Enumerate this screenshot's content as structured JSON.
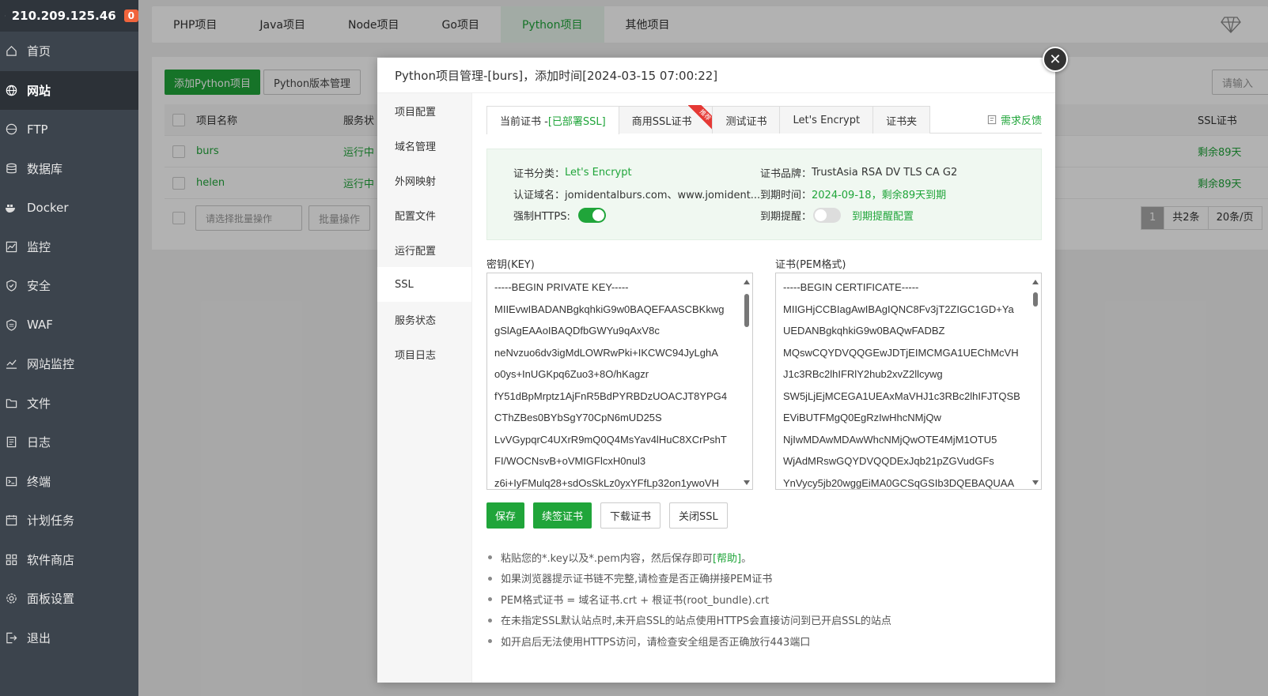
{
  "server": {
    "ip": "210.209.125.46",
    "badge": "0"
  },
  "sidebar": {
    "items": [
      {
        "label": "首页",
        "icon": "home-icon"
      },
      {
        "label": "网站",
        "icon": "globe-icon"
      },
      {
        "label": "FTP",
        "icon": "ftp-icon"
      },
      {
        "label": "数据库",
        "icon": "database-icon"
      },
      {
        "label": "Docker",
        "icon": "docker-icon"
      },
      {
        "label": "监控",
        "icon": "monitor-icon"
      },
      {
        "label": "安全",
        "icon": "shield-icon"
      },
      {
        "label": "WAF",
        "icon": "waf-icon"
      },
      {
        "label": "网站监控",
        "icon": "chart-icon"
      },
      {
        "label": "文件",
        "icon": "folder-icon"
      },
      {
        "label": "日志",
        "icon": "log-icon"
      },
      {
        "label": "终端",
        "icon": "terminal-icon"
      },
      {
        "label": "计划任务",
        "icon": "calendar-icon"
      },
      {
        "label": "软件商店",
        "icon": "apps-icon"
      },
      {
        "label": "面板设置",
        "icon": "gear-icon"
      },
      {
        "label": "退出",
        "icon": "logout-icon"
      }
    ]
  },
  "top_tabs": [
    "PHP项目",
    "Java项目",
    "Node项目",
    "Go项目",
    "Python项目",
    "其他项目"
  ],
  "page": {
    "add_button": "添加Python项目",
    "version_button": "Python版本管理",
    "search_placeholder": "请输入",
    "columns": {
      "name": "项目名称",
      "status": "服务状",
      "ssl": "SSL证书"
    },
    "rows": [
      {
        "name": "burs",
        "status": "运行中",
        "ssl": "剩余89天"
      },
      {
        "name": "helen",
        "status": "运行中",
        "ssl": "剩余89天"
      }
    ],
    "batch_placeholder": "请选择批量操作",
    "batch_button": "批量操作",
    "pager": {
      "page": "1",
      "total": "共2条",
      "per_page": "20条/页"
    }
  },
  "modal": {
    "title": "Python项目管理-[burs]，添加时间[2024-03-15 07:00:22]",
    "menu": [
      "项目配置",
      "域名管理",
      "外网映射",
      "配置文件",
      "运行配置",
      "SSL",
      "服务状态",
      "项目日志"
    ],
    "tabs": {
      "current": "当前证书 - ",
      "current_status": "[已部署SSL]",
      "commercial": "商用SSL证书",
      "ribbon": "推荐",
      "test": "测试证书",
      "letsencrypt": "Let's Encrypt",
      "folder": "证书夹"
    },
    "feedback": "需求反馈",
    "cert": {
      "category_label": "证书分类：",
      "category_value": "Let's Encrypt",
      "brand_label": "证书品牌：",
      "brand_value": "TrustAsia RSA DV TLS CA G2",
      "domain_label": "认证域名：",
      "domain_value": "jomidentalburs.com、www.jomident...",
      "expire_label": "到期时间：",
      "expire_value": "2024-09-18，剩余89天到期",
      "https_label": "强制HTTPS:",
      "remind_label": "到期提醒：",
      "remind_link": "到期提醒配置"
    },
    "key_label": "密钥(KEY)",
    "key_lines": [
      "-----BEGIN PRIVATE KEY-----",
      "MIIEvwIBADANBgkqhkiG9w0BAQEFAASCBKkwg",
      "gSlAgEAAoIBAQDfbGWYu9qAxV8c",
      "neNvzuo6dv3igMdLOWRwPki+IKCWC94JyLghA",
      "o0ys+InUGKpq6Zuo3+8O/hKagzr",
      "fY51dBpMrptz1AjFnR5BdPYRBDzUOACJT8YPG4",
      "CThZBes0BYbSgY70CpN6mUD25S",
      "LvVGypqrC4UXrR9mQ0Q4MsYav4lHuC8XCrPshT",
      "FI/WOCNsvB+oVMIGFlcxH0nul3",
      "z6i+IyFMulq28+sdOsSkLz0yxYFfLp32on1ywoVH"
    ],
    "pem_label": "证书(PEM格式)",
    "pem_lines": [
      "-----BEGIN CERTIFICATE-----",
      "MIIGHjCCBIagAwIBAgIQNC8Fv3jT2ZIGC1GD+Ya",
      "UEDANBgkqhkiG9w0BAQwFADBZ",
      "MQswCQYDVQQGEwJDTjEIMCMGA1UEChMcVH",
      "J1c3RBc2lhIFRlY2hub2xvZ2llcywg",
      "SW5jLjEjMCEGA1UEAxMaVHJ1c3RBc2lhIFJTQSB",
      "EViBUTFMgQ0EgRzIwHhcNMjQw",
      "NjIwMDAwMDAwWhcNMjQwOTE4MjM1OTU5",
      "WjAdMRswGQYDVQQDExJqb21pZGVudGFs",
      "YnVycy5jb20wggEiMA0GCSqGSIb3DQEBAQUAA"
    ],
    "buttons": {
      "save": "保存",
      "renew": "续签证书",
      "download": "下载证书",
      "close": "关闭SSL"
    },
    "tips": {
      "t1_pre": "粘贴您的*.key以及*.pem内容，然后保存即可",
      "t1_help": "[帮助]",
      "t1_post": "。",
      "t2": "如果浏览器提示证书链不完整,请检查是否正确拼接PEM证书",
      "t3": "PEM格式证书 = 域名证书.crt + 根证书(root_bundle).crt",
      "t4": "在未指定SSL默认站点时,未开启SSL的站点使用HTTPS会直接访问到已开启SSL的站点",
      "t5": "如开启后无法使用HTTPS访问，请检查安全组是否正确放行443端口"
    }
  },
  "colors": {
    "accent": "#20a53a",
    "sidebar": "#3c444d",
    "badge": "#f0643c"
  }
}
